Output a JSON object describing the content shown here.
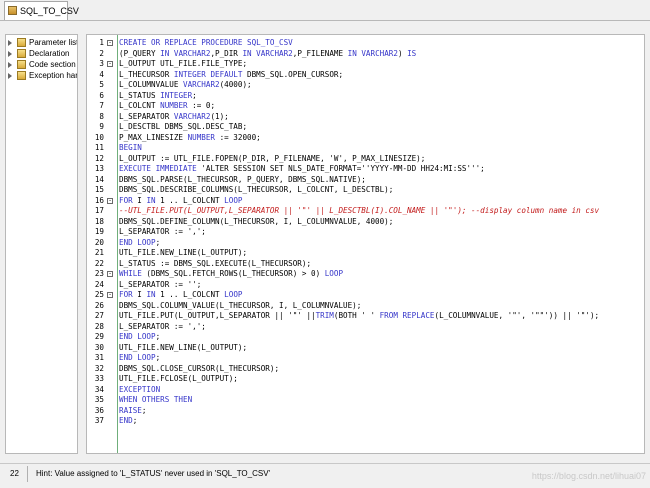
{
  "tab": {
    "label": "SQL_TO_CSV"
  },
  "tree": {
    "items": [
      {
        "label": "Parameter list"
      },
      {
        "label": "Declaration"
      },
      {
        "label": "Code section"
      },
      {
        "label": "Exception handler"
      }
    ]
  },
  "editor": {
    "lines": [
      {
        "num": "1",
        "fold": "-",
        "parts": [
          [
            "kw",
            "CREATE OR REPLACE PROCEDURE SQL_TO_CSV"
          ]
        ]
      },
      {
        "num": "2",
        "fold": "",
        "parts": [
          [
            "pl",
            "(P_QUERY "
          ],
          [
            "kw",
            "IN VARCHAR2"
          ],
          [
            "pl",
            ",P_DIR "
          ],
          [
            "kw",
            "IN VARCHAR2"
          ],
          [
            "pl",
            ",P_FILENAME "
          ],
          [
            "kw",
            "IN VARCHAR2"
          ],
          [
            "pl",
            ") "
          ],
          [
            "kw",
            "IS"
          ]
        ]
      },
      {
        "num": "3",
        "fold": "-",
        "parts": [
          [
            "pl",
            "L_OUTPUT UTL_FILE.FILE_TYPE;"
          ]
        ]
      },
      {
        "num": "4",
        "fold": "",
        "parts": [
          [
            "pl",
            "L_THECURSOR "
          ],
          [
            "kw",
            "INTEGER DEFAULT"
          ],
          [
            "pl",
            " DBMS_SQL.OPEN_CURSOR;"
          ]
        ]
      },
      {
        "num": "5",
        "fold": "",
        "parts": [
          [
            "pl",
            "L_COLUMNVALUE "
          ],
          [
            "kw",
            "VARCHAR2"
          ],
          [
            "pl",
            "(4000);"
          ]
        ]
      },
      {
        "num": "6",
        "fold": "",
        "parts": [
          [
            "pl",
            "L_STATUS "
          ],
          [
            "kw",
            "INTEGER"
          ],
          [
            "pl",
            ";"
          ]
        ]
      },
      {
        "num": "7",
        "fold": "",
        "parts": [
          [
            "pl",
            "L_COLCNT "
          ],
          [
            "kw",
            "NUMBER"
          ],
          [
            "pl",
            " := 0;"
          ]
        ]
      },
      {
        "num": "8",
        "fold": "",
        "parts": [
          [
            "pl",
            "L_SEPARATOR "
          ],
          [
            "kw",
            "VARCHAR2"
          ],
          [
            "pl",
            "(1);"
          ]
        ]
      },
      {
        "num": "9",
        "fold": "",
        "parts": [
          [
            "pl",
            "L_DESCTBL DBMS_SQL.DESC_TAB;"
          ]
        ]
      },
      {
        "num": "10",
        "fold": "",
        "parts": [
          [
            "pl",
            "P_MAX_LINESIZE "
          ],
          [
            "kw",
            "NUMBER"
          ],
          [
            "pl",
            " := 32000;"
          ]
        ]
      },
      {
        "num": "11",
        "fold": "",
        "parts": [
          [
            "kw",
            "BEGIN"
          ]
        ]
      },
      {
        "num": "12",
        "fold": "",
        "parts": [
          [
            "pl",
            "L_OUTPUT := UTL_FILE.FOPEN(P_DIR, P_FILENAME, 'W', P_MAX_LINESIZE);"
          ]
        ]
      },
      {
        "num": "13",
        "fold": "",
        "parts": [
          [
            "kw",
            "EXECUTE IMMEDIATE"
          ],
          [
            "pl",
            " 'ALTER SESSION SET NLS_DATE_FORMAT=''YYYY-MM-DD HH24:MI:SS''';"
          ]
        ]
      },
      {
        "num": "14",
        "fold": "",
        "parts": [
          [
            "pl",
            "DBMS_SQL.PARSE(L_THECURSOR, P_QUERY, DBMS_SQL.NATIVE);"
          ]
        ]
      },
      {
        "num": "15",
        "fold": "",
        "parts": [
          [
            "pl",
            "DBMS_SQL.DESCRIBE_COLUMNS(L_THECURSOR, L_COLCNT, L_DESCTBL);"
          ]
        ]
      },
      {
        "num": "16",
        "fold": "-",
        "parts": [
          [
            "kw",
            "FOR"
          ],
          [
            "pl",
            " I "
          ],
          [
            "kw",
            "IN"
          ],
          [
            "pl",
            " 1 .. L_COLCNT "
          ],
          [
            "kw",
            "LOOP"
          ]
        ]
      },
      {
        "num": "17",
        "fold": "",
        "parts": [
          [
            "cm",
            "--UTL_FILE.PUT(L_OUTPUT,L_SEPARATOR || '\"' || L_DESCTBL(I).COL_NAME || '\"'); --display column name in csv"
          ]
        ]
      },
      {
        "num": "18",
        "fold": "",
        "parts": [
          [
            "pl",
            "DBMS_SQL.DEFINE_COLUMN(L_THECURSOR, I, L_COLUMNVALUE, 4000);"
          ]
        ]
      },
      {
        "num": "19",
        "fold": "",
        "parts": [
          [
            "pl",
            "L_SEPARATOR := ',';"
          ]
        ]
      },
      {
        "num": "20",
        "fold": "",
        "parts": [
          [
            "kw",
            "END LOOP"
          ],
          [
            "pl",
            ";"
          ]
        ]
      },
      {
        "num": "21",
        "fold": "",
        "parts": [
          [
            "pl",
            "UTL_FILE.NEW_LINE(L_OUTPUT);"
          ]
        ]
      },
      {
        "num": "22",
        "fold": "",
        "parts": [
          [
            "pl",
            "L_STATUS := DBMS_SQL.EXECUTE(L_THECURSOR);"
          ]
        ]
      },
      {
        "num": "23",
        "fold": "-",
        "parts": [
          [
            "kw",
            "WHILE"
          ],
          [
            "pl",
            " (DBMS_SQL.FETCH_ROWS(L_THECURSOR) > 0) "
          ],
          [
            "kw",
            "LOOP"
          ]
        ]
      },
      {
        "num": "24",
        "fold": "",
        "parts": [
          [
            "pl",
            "L_SEPARATOR := '';"
          ]
        ]
      },
      {
        "num": "25",
        "fold": "-",
        "parts": [
          [
            "kw",
            "FOR"
          ],
          [
            "pl",
            " I "
          ],
          [
            "kw",
            "IN"
          ],
          [
            "pl",
            " 1 .. L_COLCNT "
          ],
          [
            "kw",
            "LOOP"
          ]
        ]
      },
      {
        "num": "26",
        "fold": "",
        "parts": [
          [
            "pl",
            "DBMS_SQL.COLUMN_VALUE(L_THECURSOR, I, L_COLUMNVALUE);"
          ]
        ]
      },
      {
        "num": "27",
        "fold": "",
        "parts": [
          [
            "pl",
            "UTL_FILE.PUT(L_OUTPUT,L_SEPARATOR || '\"' ||"
          ],
          [
            "kw",
            "TRIM"
          ],
          [
            "pl",
            "(BOTH ' ' "
          ],
          [
            "kw",
            "FROM"
          ],
          [
            "pl",
            " "
          ],
          [
            "kw",
            "REPLACE"
          ],
          [
            "pl",
            "(L_COLUMNVALUE, '\"', '\"\"')) || '\"');"
          ]
        ]
      },
      {
        "num": "28",
        "fold": "",
        "parts": [
          [
            "pl",
            "L_SEPARATOR := ',';"
          ]
        ]
      },
      {
        "num": "29",
        "fold": "",
        "parts": [
          [
            "kw",
            "END LOOP"
          ],
          [
            "pl",
            ";"
          ]
        ]
      },
      {
        "num": "30",
        "fold": "",
        "parts": [
          [
            "pl",
            "UTL_FILE.NEW_LINE(L_OUTPUT);"
          ]
        ]
      },
      {
        "num": "31",
        "fold": "",
        "parts": [
          [
            "kw",
            "END LOOP"
          ],
          [
            "pl",
            ";"
          ]
        ]
      },
      {
        "num": "32",
        "fold": "",
        "parts": [
          [
            "pl",
            "DBMS_SQL.CLOSE_CURSOR(L_THECURSOR);"
          ]
        ]
      },
      {
        "num": "33",
        "fold": "",
        "parts": [
          [
            "pl",
            "UTL_FILE.FCLOSE(L_OUTPUT);"
          ]
        ]
      },
      {
        "num": "34",
        "fold": "",
        "parts": [
          [
            "kw",
            "EXCEPTION"
          ]
        ]
      },
      {
        "num": "35",
        "fold": "",
        "parts": [
          [
            "kw",
            "WHEN OTHERS THEN"
          ]
        ]
      },
      {
        "num": "36",
        "fold": "",
        "parts": [
          [
            "kw",
            "RAISE"
          ],
          [
            "pl",
            ";"
          ]
        ]
      },
      {
        "num": "37",
        "fold": "",
        "parts": [
          [
            "kw",
            "END"
          ],
          [
            "pl",
            ";"
          ]
        ]
      }
    ]
  },
  "status": {
    "line": "22",
    "hint": "Hint: Value assigned to 'L_STATUS' never used in 'SQL_TO_CSV'"
  },
  "watermark": "https://blog.csdn.net/lihuai07",
  "colors": {
    "keyword": "#3535c9",
    "comment": "#c21a1a",
    "fold_line": "#6fae7a"
  }
}
